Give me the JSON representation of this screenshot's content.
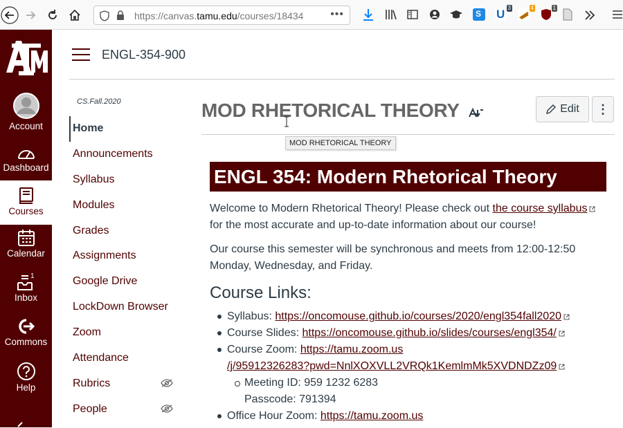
{
  "browser": {
    "url_prefix": "https://canvas.",
    "url_host": "tamu.edu",
    "url_path": "/courses/18434",
    "ext_badges": [
      "3",
      "4",
      "1"
    ]
  },
  "global_nav": {
    "items": [
      {
        "label": "Account",
        "icon": "account-icon"
      },
      {
        "label": "Dashboard",
        "icon": "dashboard-icon"
      },
      {
        "label": "Courses",
        "icon": "courses-icon"
      },
      {
        "label": "Calendar",
        "icon": "calendar-icon"
      },
      {
        "label": "Inbox",
        "icon": "inbox-icon",
        "badge": "1"
      },
      {
        "label": "Commons",
        "icon": "commons-icon"
      },
      {
        "label": "Help",
        "icon": "help-icon"
      }
    ],
    "brand_color": "#500000"
  },
  "header": {
    "breadcrumb": "ENGL-354-900"
  },
  "course_nav": {
    "term": "CS.Fall.2020",
    "items": [
      {
        "label": "Home"
      },
      {
        "label": "Announcements"
      },
      {
        "label": "Syllabus"
      },
      {
        "label": "Modules"
      },
      {
        "label": "Grades"
      },
      {
        "label": "Assignments"
      },
      {
        "label": "Google Drive"
      },
      {
        "label": "LockDown Browser"
      },
      {
        "label": "Zoom"
      },
      {
        "label": "Attendance"
      },
      {
        "label": "Rubrics"
      },
      {
        "label": "People"
      }
    ]
  },
  "page": {
    "title": "MOD RHETORICAL THEORY",
    "tooltip": "MOD RHETORICAL THEORY",
    "edit_label": "Edit",
    "more_label": "⋮",
    "banner": "ENGL 354: Modern Rhetorical Theory",
    "p1_before": "Welcome to Modern Rhetorical Theory! Please check out ",
    "p1_link": "the course syllabus",
    "p1_after": " for the most accurate and up-to-date information about our course!",
    "p2": "Our course this semester will be synchronous and meets from 12:00-12:50 Monday, Wednesday, and Friday.",
    "links_heading": "Course Links:",
    "links": {
      "syllabus_label": "Syllabus: ",
      "syllabus_url": "https://oncomouse.github.io/courses/2020/engl354fall2020",
      "slides_label": "Course Slides: ",
      "slides_url": "https://oncomouse.github.io/slides/courses/engl354/",
      "zoom_label": "Course Zoom: ",
      "zoom_url_1": "https://tamu.zoom.us",
      "zoom_url_2": "/j/95912326283?pwd=NnlXOXVLL2VRQk1KemlmMk5XVDNDZz09",
      "meeting_id": "Meeting ID: 959 1232 6283",
      "passcode": "Passcode: 791394",
      "office_label": "Office Hour Zoom: ",
      "office_url": "https://tamu.zoom.us"
    }
  }
}
